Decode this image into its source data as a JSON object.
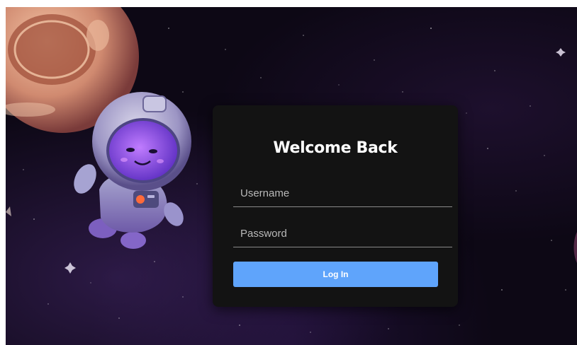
{
  "login": {
    "title": "Welcome Back",
    "username_placeholder": "Username",
    "password_placeholder": "Password",
    "button_label": "Log In"
  },
  "colors": {
    "background": "#0d0815",
    "card": "#131313",
    "button": "#5fa4fb",
    "title_text": "#ffffff",
    "placeholder_text": "#b9b9b9"
  },
  "icons": {
    "planet": "planet-illustration",
    "astronaut": "astronaut-illustration",
    "stars": "star-icon"
  }
}
